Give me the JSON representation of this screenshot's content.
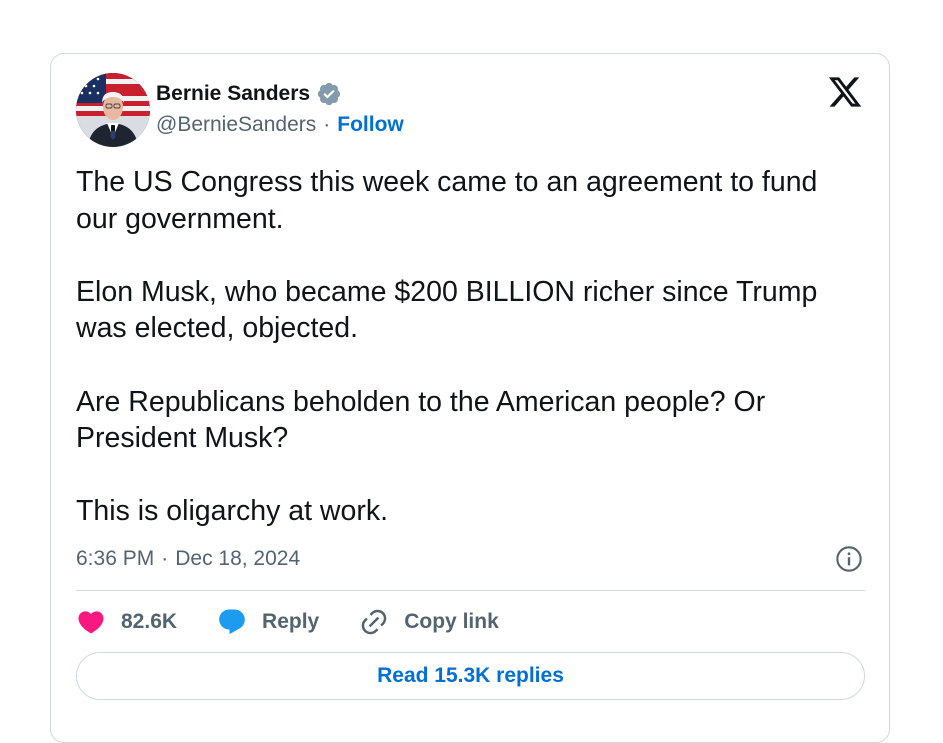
{
  "author": {
    "display_name": "Bernie Sanders",
    "handle": "@BernieSanders",
    "separator": "·",
    "follow_label": "Follow",
    "verified": true
  },
  "tweet": {
    "paragraphs": [
      "The US Congress this week came to an agreement to fund our government.",
      "Elon Musk, who became $200 BILLION richer since Trump was elected, objected.",
      "Are Republicans beholden to the American people? Or President Musk?",
      "This is oligarchy at work."
    ],
    "time": "6:36 PM",
    "separator": "·",
    "date": "Dec 18, 2024"
  },
  "actions": {
    "like_count": "82.6K",
    "reply_label": "Reply",
    "copy_link_label": "Copy link"
  },
  "read_replies_label": "Read 15.3K replies",
  "colors": {
    "accent": "#006fd6",
    "like": "#f91880",
    "reply": "#1d9bf0",
    "muted": "#536471",
    "border": "#cfd9de"
  }
}
